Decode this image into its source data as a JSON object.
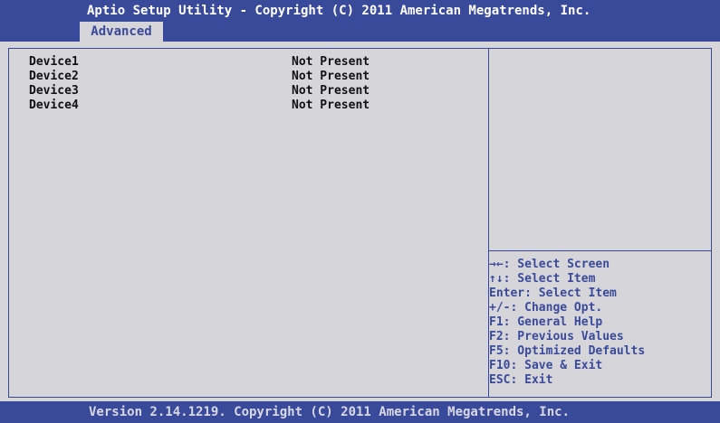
{
  "header": {
    "title": "Aptio Setup Utility - Copyright (C) 2011 American Megatrends, Inc.",
    "active_tab": "Advanced"
  },
  "devices": [
    {
      "name": "Device1",
      "status": "Not Present"
    },
    {
      "name": "Device2",
      "status": "Not Present"
    },
    {
      "name": "Device3",
      "status": "Not Present"
    },
    {
      "name": "Device4",
      "status": "Not Present"
    }
  ],
  "help": {
    "keys": [
      "→←: Select Screen",
      "↑↓:  Select Item",
      "Enter: Select Item",
      "+/-: Change Opt.",
      "F1: General Help",
      "F2: Previous Values",
      "F5: Optimized Defaults",
      "F10: Save & Exit",
      "ESC: Exit"
    ]
  },
  "footer": {
    "text": "Version 2.14.1219. Copyright (C) 2011 American Megatrends, Inc."
  },
  "colors": {
    "header_bg": "#3a4a9a",
    "panel_bg": "#d6d6da",
    "help_text": "#3a4a9a",
    "item_text": "#111111"
  }
}
